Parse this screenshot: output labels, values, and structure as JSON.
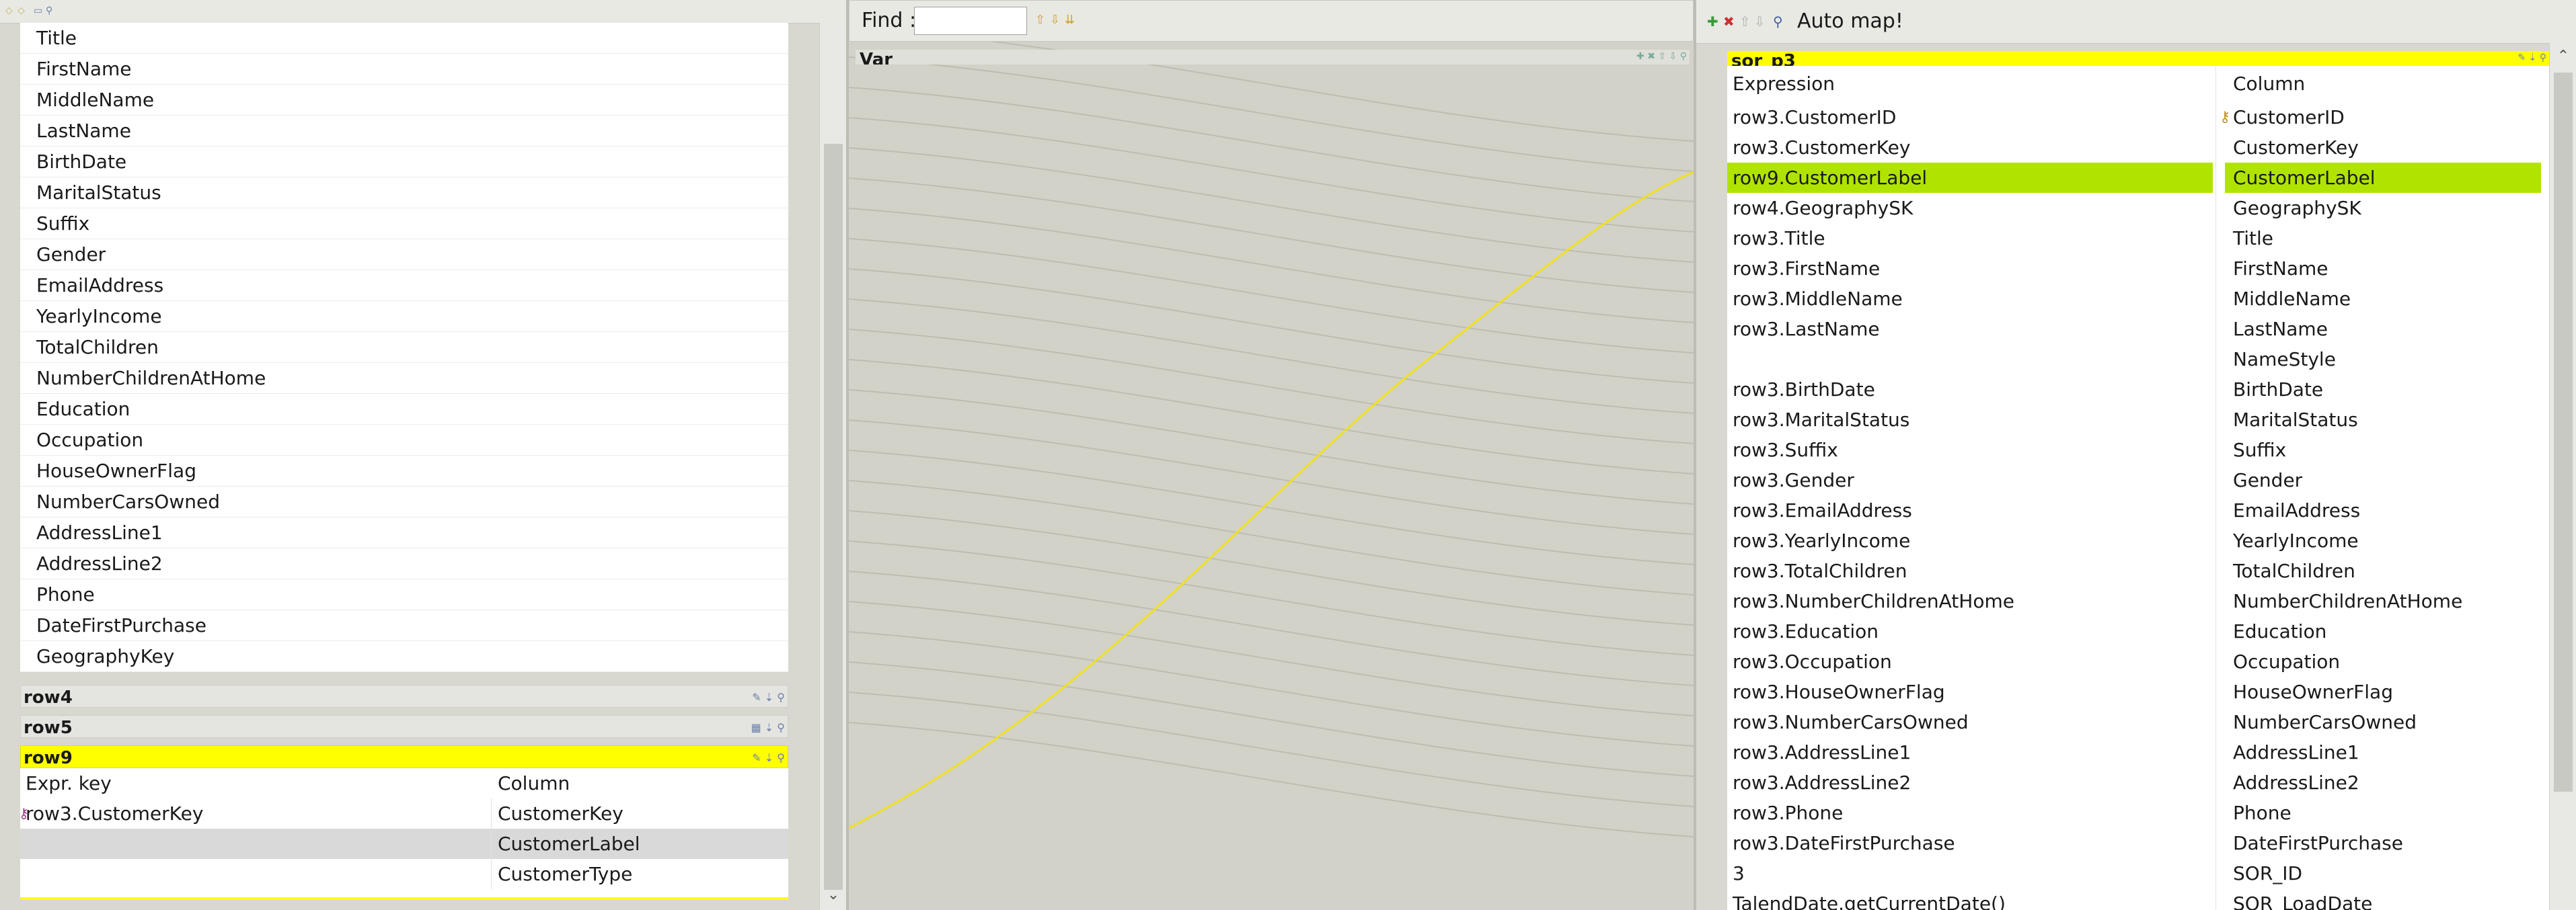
{
  "left": {
    "input_columns": [
      "Title",
      "FirstName",
      "MiddleName",
      "LastName",
      "BirthDate",
      "MaritalStatus",
      "Suffix",
      "Gender",
      "EmailAddress",
      "YearlyIncome",
      "TotalChildren",
      "NumberChildrenAtHome",
      "Education",
      "Occupation",
      "HouseOwnerFlag",
      "NumberCarsOwned",
      "AddressLine1",
      "AddressLine2",
      "Phone",
      "DateFirstPurchase",
      "GeographyKey"
    ],
    "row4": {
      "title": "row4"
    },
    "row5": {
      "title": "row5"
    },
    "row9": {
      "title": "row9",
      "header_expr": "Expr. key",
      "header_column": "Column",
      "rows": [
        {
          "expr": "row3.CustomerKey",
          "column": "CustomerKey"
        },
        {
          "expr": "",
          "column": "CustomerLabel"
        },
        {
          "expr": "",
          "column": "CustomerType"
        }
      ]
    }
  },
  "middle": {
    "find_label": "Find :",
    "find_value": "",
    "var_title": "Var"
  },
  "right": {
    "automap_label": "Auto map!",
    "output_title": "sor_p3",
    "header_expression": "Expression",
    "header_column": "Column",
    "rows": [
      {
        "expr": "row3.CustomerID",
        "column": "CustomerID"
      },
      {
        "expr": "row3.CustomerKey",
        "column": "CustomerKey"
      },
      {
        "expr": "row9.CustomerLabel",
        "column": "CustomerLabel"
      },
      {
        "expr": "row4.GeographySK",
        "column": "GeographySK"
      },
      {
        "expr": "row3.Title",
        "column": "Title"
      },
      {
        "expr": "row3.FirstName",
        "column": "FirstName"
      },
      {
        "expr": "row3.MiddleName",
        "column": "MiddleName"
      },
      {
        "expr": "row3.LastName",
        "column": "LastName"
      },
      {
        "expr": "",
        "column": "NameStyle"
      },
      {
        "expr": "row3.BirthDate",
        "column": "BirthDate"
      },
      {
        "expr": "row3.MaritalStatus",
        "column": "MaritalStatus"
      },
      {
        "expr": "row3.Suffix",
        "column": "Suffix"
      },
      {
        "expr": "row3.Gender",
        "column": "Gender"
      },
      {
        "expr": "row3.EmailAddress",
        "column": "EmailAddress"
      },
      {
        "expr": "row3.YearlyIncome",
        "column": "YearlyIncome"
      },
      {
        "expr": "row3.TotalChildren",
        "column": "TotalChildren"
      },
      {
        "expr": "row3.NumberChildrenAtHome",
        "column": "NumberChildrenAtHome"
      },
      {
        "expr": "row3.Education",
        "column": "Education"
      },
      {
        "expr": "row3.Occupation",
        "column": "Occupation"
      },
      {
        "expr": "row3.HouseOwnerFlag",
        "column": "HouseOwnerFlag"
      },
      {
        "expr": "row3.NumberCarsOwned",
        "column": "NumberCarsOwned"
      },
      {
        "expr": "row3.AddressLine1",
        "column": "AddressLine1"
      },
      {
        "expr": "row3.AddressLine2",
        "column": "AddressLine2"
      },
      {
        "expr": "row3.Phone",
        "column": "Phone"
      },
      {
        "expr": "row3.DateFirstPurchase",
        "column": "DateFirstPurchase"
      },
      {
        "expr": "3",
        "column": "SOR_ID"
      },
      {
        "expr": "TalendDate.getCurrentDate()",
        "column": "SOR_LoadDate"
      }
    ],
    "highlight_row": "row9.CustomerLabel",
    "key_column": "CustomerID"
  },
  "colors": {
    "yellow": "#ffff00",
    "highlight_green": "#b0e400",
    "link_line": "#f0e020"
  },
  "icons": {
    "key": "key-icon",
    "add": "add-icon",
    "remove": "remove-icon",
    "move-up": "arrow-up-icon",
    "move-down": "arrow-down-icon"
  }
}
